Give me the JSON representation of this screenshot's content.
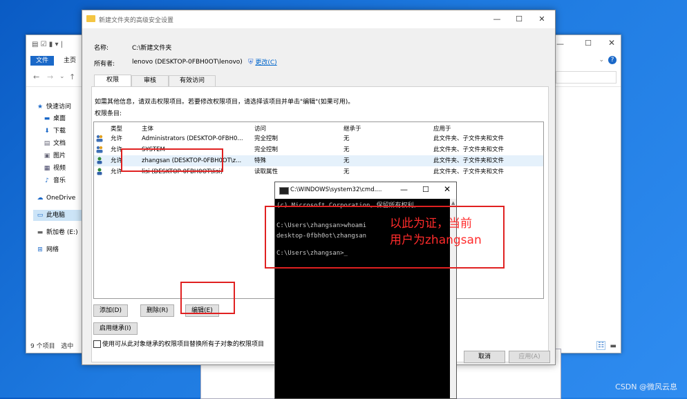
{
  "explorer": {
    "ribbon_tabs": [
      "文件",
      "主页"
    ],
    "sidebar": [
      {
        "icon": "star-icon",
        "label": "快速访问"
      },
      {
        "icon": "desktop-icon",
        "label": "桌面"
      },
      {
        "icon": "download-icon",
        "label": "下载"
      },
      {
        "icon": "document-icon",
        "label": "文档"
      },
      {
        "icon": "picture-icon",
        "label": "图片"
      },
      {
        "icon": "video-icon",
        "label": "视频"
      },
      {
        "icon": "music-icon",
        "label": "音乐"
      },
      {
        "icon": "cloud-icon",
        "label": "OneDrive"
      },
      {
        "icon": "pc-icon",
        "label": "此电脑"
      },
      {
        "icon": "drive-icon",
        "label": "新加卷 (E:)"
      },
      {
        "icon": "network-icon",
        "label": "网络"
      }
    ],
    "status_items": "9 个项目",
    "status_selected": "选中"
  },
  "dialog": {
    "title": "新建文件夹的高级安全设置",
    "name_label": "名称:",
    "name_value": "C:\\新建文件夹",
    "owner_label": "所有者:",
    "owner_value": "lenovo (DESKTOP-0FBH0OT\\lenovo)",
    "change_link": "更改(C)",
    "tabs": [
      "权限",
      "审核",
      "有效访问"
    ],
    "info": "如需其他信息，请双击权限项目。若要修改权限项目，请选择该项目并单击\"编辑\"(如果可用)。",
    "entries_label": "权限条目:",
    "columns": [
      "类型",
      "主体",
      "访问",
      "继承于",
      "应用于"
    ],
    "rows": [
      {
        "type": "允许",
        "principal": "Administrators (DESKTOP-0FBH0...",
        "access": "完全控制",
        "inherit": "无",
        "apply": "此文件夹、子文件夹和文件"
      },
      {
        "type": "允许",
        "principal": "SYSTEM",
        "access": "完全控制",
        "inherit": "无",
        "apply": "此文件夹、子文件夹和文件"
      },
      {
        "type": "允许",
        "principal": "zhangsan (DESKTOP-0FBH0OT\\z...",
        "access": "特殊",
        "inherit": "无",
        "apply": "此文件夹、子文件夹和文件"
      },
      {
        "type": "允许",
        "principal": "lisi (DESKTOP-0FBH0OT\\lisi)",
        "access": "读取属性",
        "inherit": "无",
        "apply": "此文件夹、子文件夹和文件"
      }
    ],
    "add_button": "添加(D)",
    "remove_button": "删除(R)",
    "edit_button": "编辑(E)",
    "inherit_button": "启用继承(I)",
    "replace_checkbox": "使用可从此对象继承的权限项目替换所有子对象的权限项目",
    "cancel_button": "取消",
    "apply_button": "应用(A)"
  },
  "cmd": {
    "title": "C:\\WINDOWS\\system32\\cmd....",
    "lines": [
      "(c) Microsoft Corporation。保留所有权利。",
      "",
      "C:\\Users\\zhangsan>whoami",
      "desktop-0fbh0ot\\zhangsan",
      "",
      "C:\\Users\\zhangsan>_"
    ]
  },
  "annotation": {
    "line1": "以此为证，当前",
    "line2": "用户为zhangsan"
  },
  "watermark": "CSDN @微风云息",
  "colors": {
    "highlight_red": "#e02020",
    "annot_red": "#ff2b2b",
    "desktop_blue": "#1e7ae0"
  }
}
